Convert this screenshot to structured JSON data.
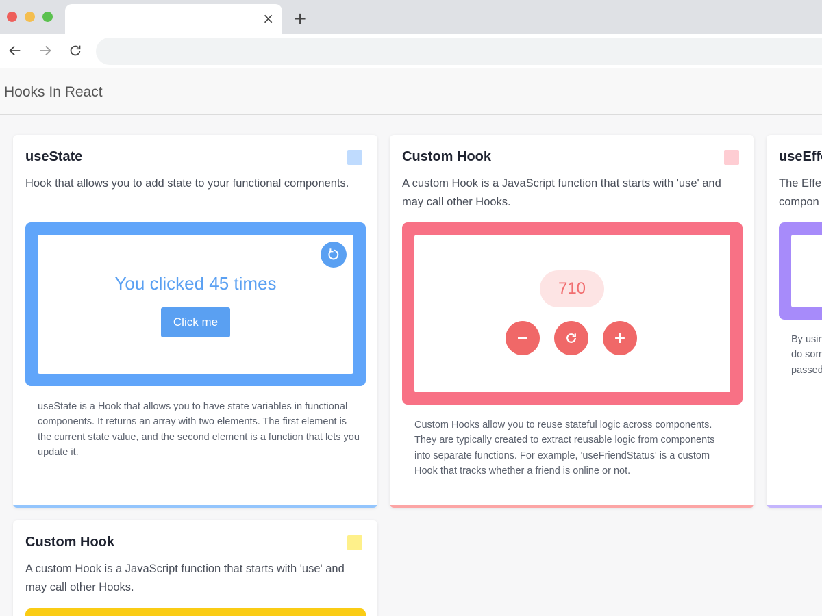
{
  "browser": {
    "tab_close_glyph": "×",
    "new_tab_glyph": "+"
  },
  "app": {
    "title": "Hooks In React"
  },
  "cards": [
    {
      "title": "useState",
      "description": "Hook that allows you to add state to your functional components.",
      "swatch_color": "#bfdbfe",
      "accent_color": "#60a5fa",
      "demo": {
        "clicked_text": "You clicked 45 times",
        "count": 45,
        "button_label": "Click me"
      },
      "note": "useState is a Hook that allows you to have state variables in functional components. It returns an array with two elements. The first element is the current state value, and the second element is a function that lets you update it."
    },
    {
      "title": "Custom Hook",
      "description": "A custom Hook is a JavaScript function that starts with 'use' and may call other Hooks.",
      "swatch_color": "#fecdd3",
      "accent_color": "#f87185",
      "demo": {
        "counter_value": "710",
        "decrement_glyph": "−",
        "increment_glyph": "+"
      },
      "note": "Custom Hooks allow you to reuse stateful logic across components. They are typically created to extract reusable logic from components into separate functions. For example, 'useFriendStatus' is a custom Hook that tracks whether a friend is online or not."
    },
    {
      "title": "useEffe",
      "description_lines": [
        "The Effe",
        "compon"
      ],
      "accent_color": "#a78bfa",
      "note_lines": [
        "By usin",
        "do som",
        "passed"
      ]
    },
    {
      "title": "Custom Hook",
      "description": "A custom Hook is a JavaScript function that starts with 'use' and may call other Hooks.",
      "swatch_color": "#fef08a",
      "accent_color": "#facc15"
    }
  ]
}
